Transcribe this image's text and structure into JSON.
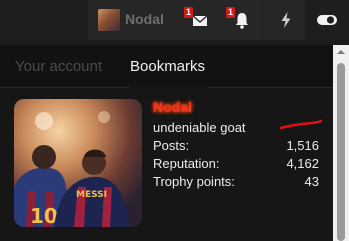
{
  "nav": {
    "username": "Nodal",
    "icons": [
      "envelope-icon",
      "bell-icon",
      "flash-icon",
      "toggle-icon"
    ],
    "conversations_badge": "1",
    "alerts_badge": "1"
  },
  "panel": {
    "tabs": [
      {
        "label": "Your account",
        "active": false
      },
      {
        "label": "Bookmarks",
        "active": true
      }
    ]
  },
  "profile": {
    "username": "Nodal",
    "user_title": "undeniable goat",
    "stats": [
      {
        "label": "Posts:",
        "value": "1,516"
      },
      {
        "label": "Reputation:",
        "value": "4,162"
      },
      {
        "label": "Trophy points:",
        "value": "43"
      }
    ]
  },
  "colors": {
    "background": "#1b1b1b",
    "badge": "#d31a1a",
    "username_glow": "#ff2b2b",
    "scribble": "#e0101a"
  }
}
